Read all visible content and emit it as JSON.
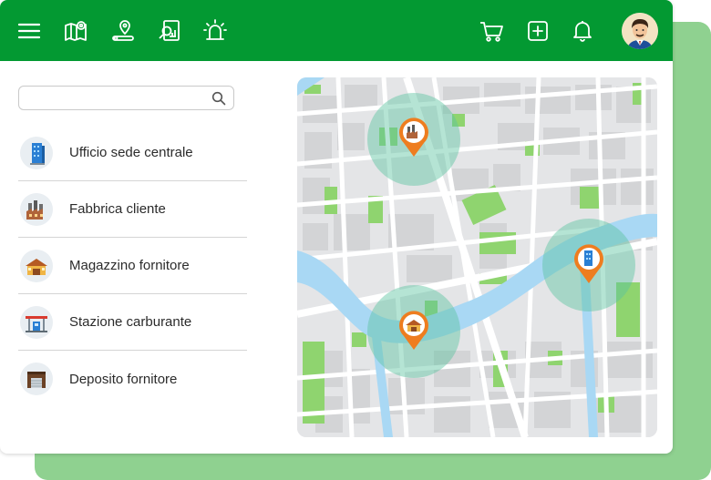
{
  "colors": {
    "topbar": "#039932",
    "accent_back": "#8fd190",
    "marker": "#ee7d1f",
    "radius_halo": "#5cc4a0",
    "water": "#a9d8f4",
    "park": "#8fd46f",
    "road": "#ffffff",
    "block": "#d6d7d9"
  },
  "topbar": {
    "icons": [
      "menu-icon",
      "map-icon",
      "location-route-icon",
      "document-analysis-icon",
      "alert-siren-icon",
      "cart-icon",
      "add-icon",
      "bell-icon"
    ],
    "avatar": "user-avatar"
  },
  "search": {
    "placeholder": "",
    "value": ""
  },
  "locations": [
    {
      "label": "Ufficio sede centrale",
      "icon": "office-building-icon"
    },
    {
      "label": "Fabbrica cliente",
      "icon": "factory-icon"
    },
    {
      "label": "Magazzino fornitore",
      "icon": "warehouse-icon"
    },
    {
      "label": "Stazione carburante",
      "icon": "fuel-station-icon"
    },
    {
      "label": "Deposito fornitore",
      "icon": "depot-icon"
    }
  ],
  "map": {
    "markers": [
      {
        "icon": "factory-icon"
      },
      {
        "icon": "office-building-icon"
      },
      {
        "icon": "warehouse-icon"
      }
    ]
  }
}
